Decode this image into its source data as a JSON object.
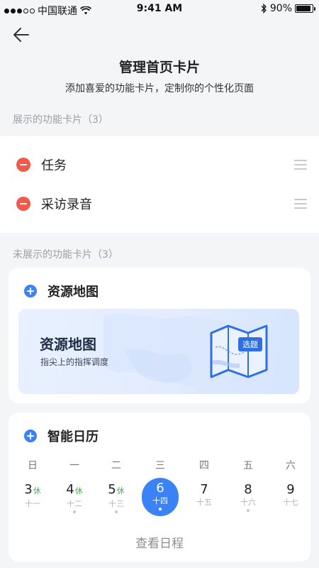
{
  "status_bar": {
    "carrier": "中国联通",
    "time": "9:41 AM",
    "battery": "90%",
    "battery_level": 0.9
  },
  "header": {
    "title": "管理首页卡片",
    "subtitle": "添加喜爱的功能卡片，定制你的个性化页面"
  },
  "shown_section": {
    "label": "展示的功能卡片（3）",
    "items": [
      {
        "label": "任务"
      },
      {
        "label": "采访录音"
      }
    ]
  },
  "hidden_section": {
    "label": "未展示的功能卡片（3）"
  },
  "map_card": {
    "title": "资源地图",
    "banner_title": "资源地图",
    "banner_subtitle": "指尖上的指挥调度",
    "badge": "选题"
  },
  "calendar_card": {
    "title": "智能日历",
    "weekdays": [
      "日",
      "一",
      "二",
      "三",
      "四",
      "五",
      "六"
    ],
    "days": [
      {
        "day": "3",
        "lunar": "十一",
        "rest": "休",
        "dot": false,
        "selected": false
      },
      {
        "day": "4",
        "lunar": "十二",
        "rest": "休",
        "dot": true,
        "selected": false
      },
      {
        "day": "5",
        "lunar": "十三",
        "rest": "休",
        "dot": true,
        "selected": false
      },
      {
        "day": "6",
        "lunar": "十四",
        "rest": "",
        "dot": true,
        "selected": true
      },
      {
        "day": "7",
        "lunar": "十五",
        "rest": "",
        "dot": false,
        "selected": false
      },
      {
        "day": "8",
        "lunar": "十六",
        "rest": "",
        "dot": true,
        "selected": false
      },
      {
        "day": "9",
        "lunar": "十七",
        "rest": "",
        "dot": false,
        "selected": false
      }
    ],
    "link": "查看日程"
  },
  "colors": {
    "accent": "#3b82f6",
    "remove": "#f05a4a",
    "rest": "#4caf50",
    "background": "#f4f5f7"
  }
}
